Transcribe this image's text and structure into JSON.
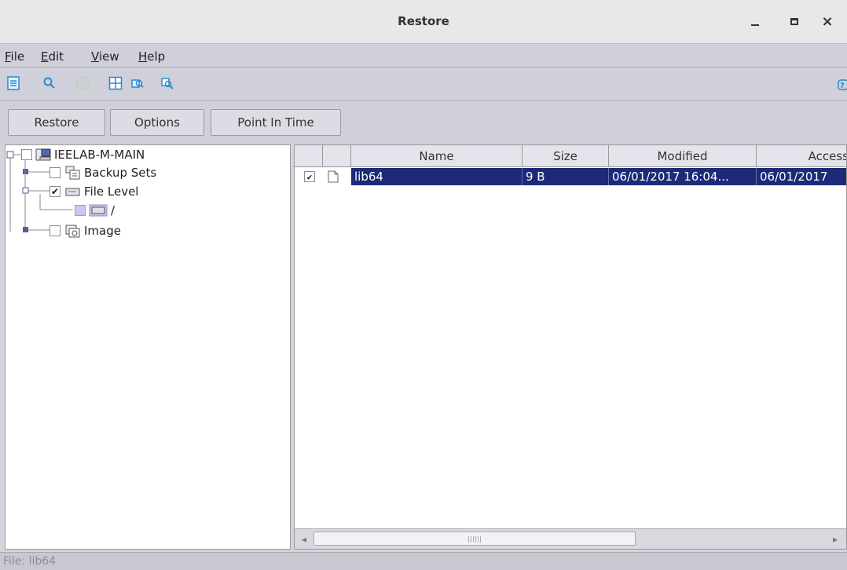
{
  "window": {
    "title": "Restore",
    "controls": {
      "minimize": "minimize",
      "maximize": "maximize",
      "close": "×"
    }
  },
  "menu": [
    "File",
    "Edit",
    "View",
    "Help"
  ],
  "toolbar": {
    "icons": [
      "list-icon",
      "search-icon",
      "disabled-grid-icon",
      "table-icon",
      "browse-icon",
      "browse-alt-icon"
    ],
    "help_icon": "help-icon",
    "accent": "#2a8ad0"
  },
  "tabs": [
    "Restore",
    "Options",
    "Point In Time"
  ],
  "tree": {
    "root": {
      "label": "IEELAB-M-MAIN",
      "checked": false
    },
    "children": [
      {
        "label": "Backup Sets",
        "checked": false
      },
      {
        "label": "File Level",
        "checked": true
      },
      {
        "label": "/",
        "checked": false
      },
      {
        "label": "Image",
        "checked": false
      }
    ]
  },
  "table": {
    "columns": [
      "",
      "",
      "Name",
      "Size",
      "Modified",
      "Access"
    ],
    "rows": [
      {
        "checked": true,
        "name": "lib64",
        "size": "9  B",
        "modified": "06/01/2017 16:04...",
        "access": "06/01/2017"
      }
    ],
    "selection_color": "#1c2a78"
  },
  "status": {
    "text": "File: lib64"
  }
}
